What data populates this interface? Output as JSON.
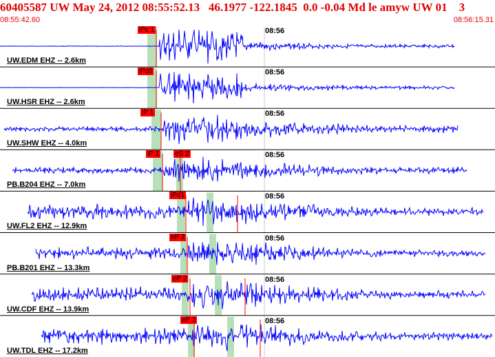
{
  "header": {
    "title": "60405587 UW May 24, 2012 08:55:52.13   46.1977 -122.1845  0.0 -0.04 Md le amyw UW 01    3",
    "start_time": "08:55:42.60",
    "end_time": "08:56:15.31"
  },
  "colors": {
    "header_text": "#e00000",
    "trace": "#0000ff",
    "pick_box": "#ff0000",
    "pick_window": "#b8e0b8",
    "separator": "#000000"
  },
  "traces": [
    {
      "label": "UW.EDM EHZ -- 2.6km",
      "minute": "08:56",
      "picks": [
        "iPc 1"
      ]
    },
    {
      "label": "UW.HSR EHZ -- 2.6km",
      "minute": "08:56",
      "picks": [
        "iPc0"
      ]
    },
    {
      "label": "UW.SHW EHZ -- 4.0km",
      "minute": "08:56",
      "picks": [
        "iP 1"
      ]
    },
    {
      "label": "PB.B204 EHZ -- 7.0km",
      "minute": "08:56",
      "picks": [
        "iP 1",
        "eS 2"
      ]
    },
    {
      "label": "UW.FL2 EHZ -- 12.9km",
      "minute": "08:56",
      "picks": [
        "iPd1"
      ]
    },
    {
      "label": "PB.B201 EHZ -- 13.3km",
      "minute": "08:56",
      "picks": [
        "eP 2"
      ]
    },
    {
      "label": "UW.CDF EHZ -- 13.9km",
      "minute": "08:56",
      "picks": [
        "eP 2"
      ]
    },
    {
      "label": "UW.TDL EHZ -- 17.2km",
      "minute": "08:56",
      "picks": [
        "eP 2"
      ]
    }
  ]
}
